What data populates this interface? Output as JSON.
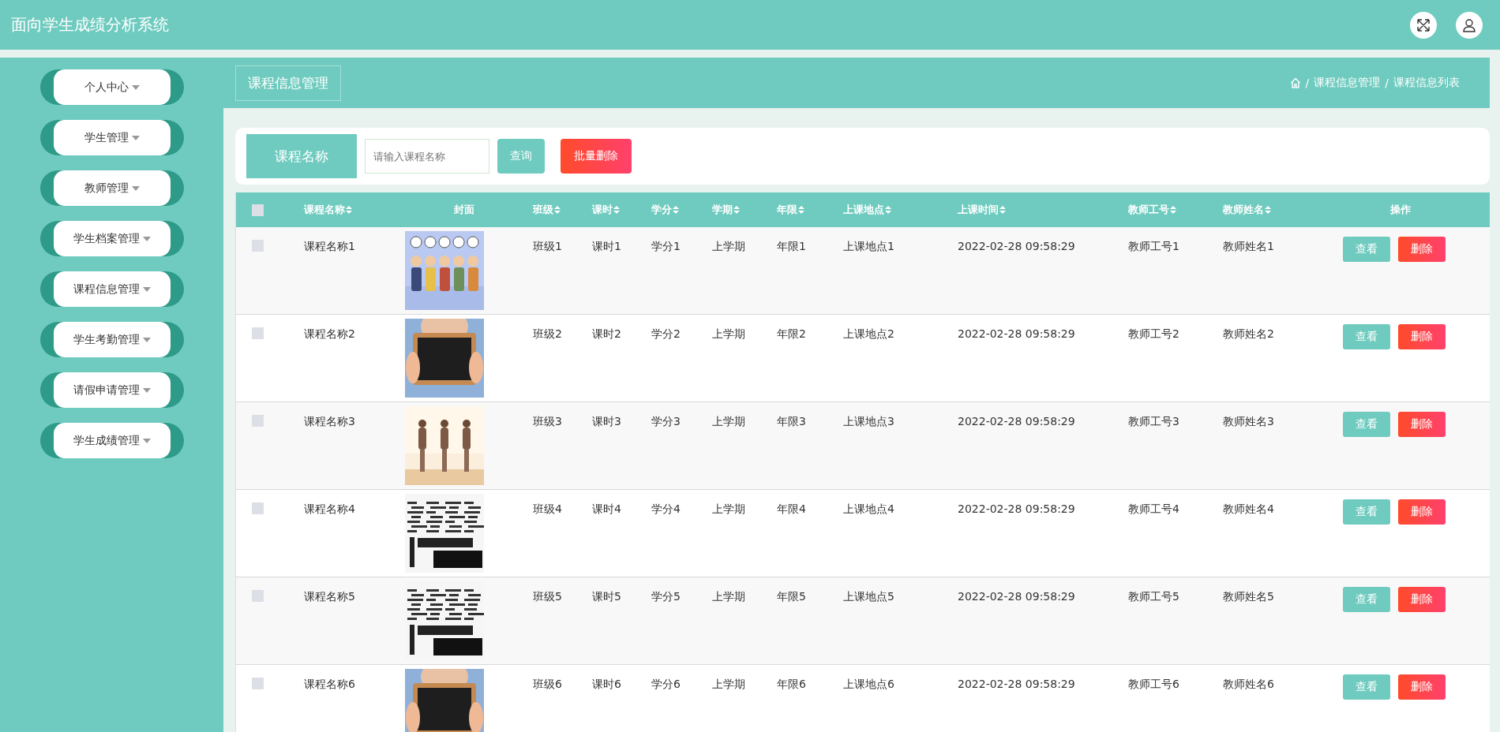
{
  "header": {
    "title": "面向学生成绩分析系统"
  },
  "sidebar": {
    "items": [
      {
        "label": "个人中心",
        "expanded": false
      },
      {
        "label": "学生管理",
        "expanded": false
      },
      {
        "label": "教师管理",
        "expanded": false
      },
      {
        "label": "学生档案管理",
        "expanded": false
      },
      {
        "label": "课程信息管理",
        "expanded": false
      },
      {
        "label": "学生考勤管理",
        "expanded": false
      },
      {
        "label": "请假申请管理",
        "expanded": false
      },
      {
        "label": "学生成绩管理",
        "expanded": false
      }
    ]
  },
  "page_title": "课程信息管理",
  "breadcrumb": {
    "separator": "/",
    "items": [
      "课程信息管理",
      "课程信息列表"
    ]
  },
  "search": {
    "label": "课程名称",
    "placeholder": "请输入课程名称",
    "query_button": "查询",
    "batch_delete_button": "批量删除"
  },
  "table": {
    "select_all": {
      "checked": false
    },
    "columns": [
      {
        "label": "课程名称",
        "sortable": true
      },
      {
        "label": "封面",
        "sortable": false
      },
      {
        "label": "班级",
        "sortable": true
      },
      {
        "label": "课时",
        "sortable": true
      },
      {
        "label": "学分",
        "sortable": true
      },
      {
        "label": "学期",
        "sortable": true
      },
      {
        "label": "年限",
        "sortable": true
      },
      {
        "label": "上课地点",
        "sortable": true
      },
      {
        "label": "上课时间",
        "sortable": true
      },
      {
        "label": "教师工号",
        "sortable": true
      },
      {
        "label": "教师姓名",
        "sortable": true
      },
      {
        "label": "操作",
        "sortable": false
      }
    ],
    "rows": [
      {
        "checked": false,
        "cells": [
          "课程名称1",
          {
            "kind": "picture"
          },
          "班级1",
          "课时1",
          "学分1",
          "上学期",
          "年限1",
          "上课地点1",
          "2022-02-28 09:58:29",
          "教师工号1",
          "教师姓名1"
        ],
        "actions": [
          "查看",
          "删除"
        ]
      },
      {
        "checked": false,
        "cells": [
          "课程名称2",
          {
            "kind": "picture"
          },
          "班级2",
          "课时2",
          "学分2",
          "上学期",
          "年限2",
          "上课地点2",
          "2022-02-28 09:58:29",
          "教师工号2",
          "教师姓名2"
        ],
        "actions": [
          "查看",
          "删除"
        ]
      },
      {
        "checked": false,
        "cells": [
          "课程名称3",
          {
            "kind": "picture"
          },
          "班级3",
          "课时3",
          "学分3",
          "上学期",
          "年限3",
          "上课地点3",
          "2022-02-28 09:58:29",
          "教师工号3",
          "教师姓名3"
        ],
        "actions": [
          "查看",
          "删除"
        ]
      },
      {
        "checked": false,
        "cells": [
          "课程名称4",
          {
            "kind": "picture"
          },
          "班级4",
          "课时4",
          "学分4",
          "上学期",
          "年限4",
          "上课地点4",
          "2022-02-28 09:58:29",
          "教师工号4",
          "教师姓名4"
        ],
        "actions": [
          "查看",
          "删除"
        ]
      },
      {
        "checked": false,
        "cells": [
          "课程名称5",
          {
            "kind": "picture"
          },
          "班级5",
          "课时5",
          "学分5",
          "上学期",
          "年限5",
          "上课地点5",
          "2022-02-28 09:58:29",
          "教师工号5",
          "教师姓名5"
        ],
        "actions": [
          "查看",
          "删除"
        ]
      },
      {
        "checked": false,
        "cells": [
          "课程名称6",
          {
            "kind": "picture"
          },
          "班级6",
          "课时6",
          "学分6",
          "上学期",
          "年限6",
          "上课地点6",
          "2022-02-28 09:58:29",
          "教师工号6",
          "教师姓名6"
        ],
        "actions": [
          "查看",
          "删除"
        ]
      }
    ]
  }
}
